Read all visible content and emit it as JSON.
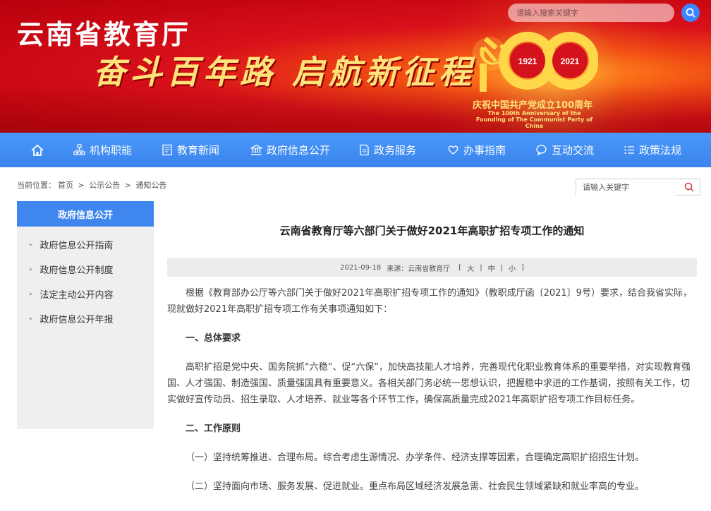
{
  "header": {
    "site_title": "云南省教育厅",
    "slogan": "奋斗百年路 启航新征程",
    "anniversary": {
      "number": "100",
      "year_start": "1921",
      "year_end": "2021",
      "title_cn": "庆祝中国共产党成立100周年",
      "title_en": "The 100th Anniversary of the Founding of The Communist Party of China"
    },
    "search_placeholder": "请输入搜索关键字"
  },
  "nav": {
    "items": [
      {
        "label": "机构职能",
        "icon": "org-chart-icon"
      },
      {
        "label": "教育新闻",
        "icon": "news-icon"
      },
      {
        "label": "政府信息公开",
        "icon": "government-building-icon"
      },
      {
        "label": "政务服务",
        "icon": "document-icon"
      },
      {
        "label": "办事指南",
        "icon": "heart-hands-icon"
      },
      {
        "label": "互动交流",
        "icon": "chat-icon"
      },
      {
        "label": "政策法规",
        "icon": "list-icon"
      }
    ]
  },
  "breadcrumb": {
    "prefix": "当前位置：",
    "items": [
      "首页",
      "公示公告",
      "通知公告"
    ],
    "separator": ">"
  },
  "side_search": {
    "placeholder": "请输入关键字"
  },
  "sidebar": {
    "heading": "政府信息公开",
    "items": [
      "政府信息公开指南",
      "政府信息公开制度",
      "法定主动公开内容",
      "政府信息公开年报"
    ]
  },
  "article": {
    "title": "云南省教育厅等六部门关于做好2021年高职扩招专项工作的通知",
    "date": "2021-09-18",
    "source": "来源：云南省教育厅",
    "size_labels": [
      "[",
      "大",
      "|",
      "中",
      "|",
      "小",
      "]"
    ],
    "paragraphs": [
      {
        "type": "p",
        "text": "根据《教育部办公厅等六部门关于做好2021年高职扩招专项工作的通知》（教职成厅函〔2021〕9号）要求，结合我省实际，现就做好2021年高职扩招专项工作有关事项通知如下："
      },
      {
        "type": "h",
        "text": "一、总体要求"
      },
      {
        "type": "p",
        "text": "高职扩招是党中央、国务院抓“六稳”、促“六保”，加快高技能人才培养，完善现代化职业教育体系的重要举措，对实现教育强国、人才强国、制造强国、质量强国具有重要意义。各相关部门务必统一思想认识，把握稳中求进的工作基调，按照有关工作，切实做好宣传动员、招生录取、人才培养、就业等各个环节工作，确保高质量完成2021年高职扩招专项工作目标任务。"
      },
      {
        "type": "h",
        "text": "二、工作原则"
      },
      {
        "type": "p",
        "text": "（一）坚持统筹推进、合理布局。综合考虑生源情况、办学条件、经济支撑等因素，合理确定高职扩招招生计划。"
      },
      {
        "type": "p",
        "text": "（二）坚持面向市场、服务发展、促进就业。重点布局区域经济发展急需、社会民生领域紧缺和就业率高的专业。"
      }
    ]
  },
  "colors": {
    "banner_red": "#d8101a",
    "nav_blue": "#3f8cf3",
    "sidebar_head_blue": "#3f86ef",
    "gold": "#ffe27a"
  }
}
